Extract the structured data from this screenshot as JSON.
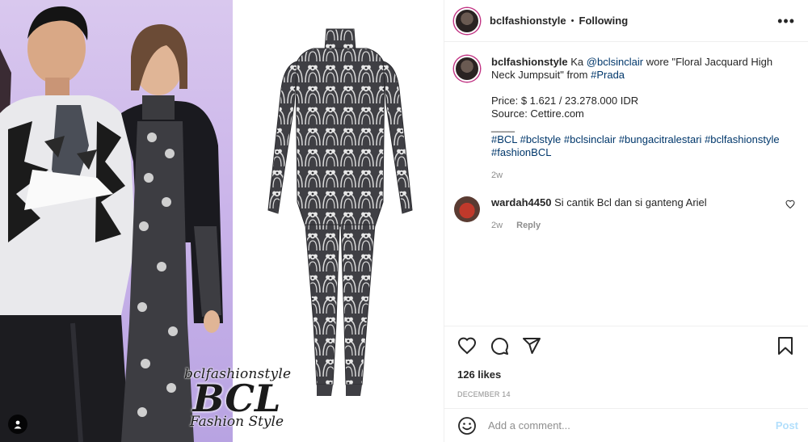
{
  "post": {
    "username": "bclfashionstyle",
    "separator": "•",
    "follow_status": "Following",
    "more_icon": "•••"
  },
  "caption": {
    "username": "bclfashionstyle",
    "text_1": "Ka",
    "mention": "@bclsinclair",
    "text_2": "wore \"Floral Jacquard High Neck Jumpsuit\" from",
    "brand_tag": "#Prada",
    "price": "Price: $ 1.621 / 23.278.000 IDR",
    "source": "Source: Cettire.com",
    "divider": "____",
    "hashtags": [
      "#BCL",
      "#bclstyle",
      "#bclsinclair",
      "#bungacitralestari",
      "#bclfashionstyle",
      "#fashionBCL"
    ],
    "time": "2w"
  },
  "comment": {
    "username": "wardah4450",
    "text": "Si cantik Bcl dan si ganteng Ariel",
    "time": "2w",
    "reply": "Reply"
  },
  "stats": {
    "likes": "126 likes",
    "date": "December 14"
  },
  "composer": {
    "placeholder": "Add a comment...",
    "post_label": "Post"
  },
  "watermark": {
    "top": "bclfashionstyle",
    "mid": "BCL",
    "bottom": "Fashion Style"
  },
  "colors": {
    "link": "#00376b",
    "muted": "#8e8e8e",
    "post_disabled": "#b2dffc"
  }
}
